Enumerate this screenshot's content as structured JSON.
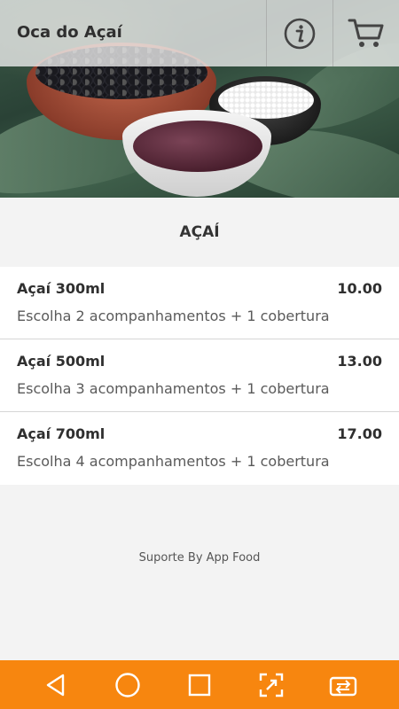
{
  "app": {
    "title": "Oca do Açaí"
  },
  "header": {
    "info_icon": "info-icon",
    "cart_icon": "cart-icon"
  },
  "section": {
    "title": "AÇAÍ"
  },
  "menu": {
    "items": [
      {
        "name": "Açaí 300ml",
        "price": "10.00",
        "description": "Escolha 2 acompanhamentos + 1 cobertura"
      },
      {
        "name": "Açaí 500ml",
        "price": "13.00",
        "description": "Escolha 3 acompanhamentos + 1 cobertura"
      },
      {
        "name": "Açaí 700ml",
        "price": "17.00",
        "description": "Escolha 4 acompanhamentos + 1 cobertura"
      }
    ]
  },
  "footer": {
    "text": "Suporte By App Food"
  },
  "navbar": {
    "color": "#f7860f",
    "buttons": [
      "back-icon",
      "home-icon",
      "recents-icon",
      "screenshot-icon",
      "cast-icon"
    ]
  }
}
